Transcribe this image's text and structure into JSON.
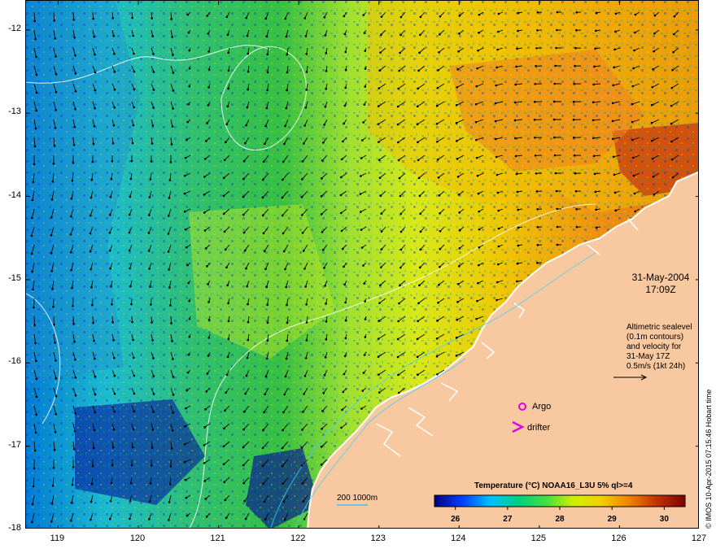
{
  "map": {
    "y_axis_ticks": [
      "-12",
      "-13",
      "-14",
      "-15",
      "-16",
      "-17",
      "-18"
    ],
    "x_axis_ticks": [
      "119",
      "120",
      "121",
      "122",
      "123",
      "124",
      "125",
      "126",
      "127"
    ],
    "lon_range": [
      118.6,
      127.0
    ],
    "lat_range": [
      -18.0,
      -11.65
    ]
  },
  "date": {
    "line1": "31-May-2004",
    "line2": "17:09Z"
  },
  "altimetry_note": {
    "line1": "Altimetric sealevel",
    "line2": "(0.1m contours)",
    "line3": "and velocity for",
    "line4": "31-May 17Z",
    "line5": "0.5m/s (1kt 24h)"
  },
  "legend": {
    "argo_label": "Argo",
    "drifter_label": "drifter",
    "depth_label": "200  1000m",
    "argo_color": "#e000e0",
    "drifter_color": "#e000e0",
    "depth_color": "#40c0ff"
  },
  "colorbar": {
    "title": "Temperature (°C) NOAA16_L3U 5% ql>=4",
    "ticks": [
      "26",
      "27",
      "28",
      "29",
      "30"
    ],
    "tick_values": [
      26,
      27,
      28,
      29,
      30
    ],
    "range": [
      25.6,
      30.4
    ],
    "stops": [
      "#000080",
      "#0040ff",
      "#00c0ff",
      "#00d080",
      "#40e040",
      "#d0f000",
      "#f0d000",
      "#f08000",
      "#c03000",
      "#800000"
    ]
  },
  "credit": "© IMOS 10-Apr-2015 07:15:46 Hobart time",
  "colors": {
    "land": "#f8c8a0",
    "coast": "#ffffff"
  }
}
